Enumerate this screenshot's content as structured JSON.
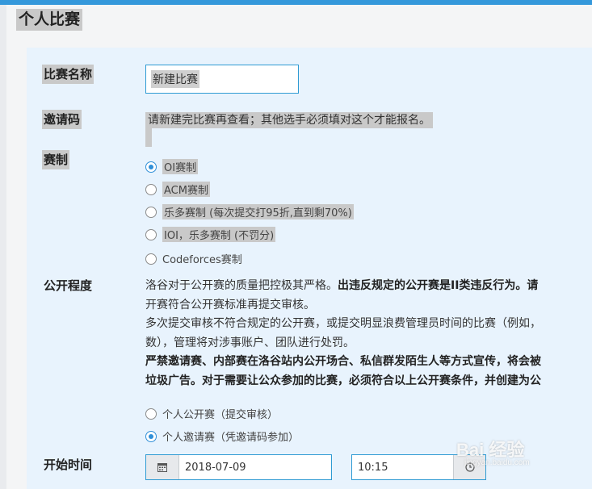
{
  "page": {
    "title": "个人比赛"
  },
  "form": {
    "name": {
      "label": "比赛名称",
      "value": "新建比赛"
    },
    "invite": {
      "label": "邀请码",
      "text": "请新建完比赛再查看；其他选手必须填对这个才能报名。"
    },
    "format": {
      "label": "赛制",
      "options": [
        {
          "label": "OI赛制",
          "checked": true
        },
        {
          "label": "ACM赛制",
          "checked": false
        },
        {
          "label": "乐多赛制 (每次提交打95折,直到剩70%)",
          "checked": false
        },
        {
          "label": "IOI，乐多赛制 (不罚分)",
          "checked": false
        },
        {
          "label": "Codeforces赛制",
          "checked": false
        }
      ]
    },
    "visibility": {
      "label": "公开程度",
      "paragraph": {
        "line1a": "洛谷对于公开赛的质量把控极其严格。",
        "line1b": "出违反规定的公开赛是II类违反行为。",
        "line1c": "请",
        "line2": "开赛符合公开赛标准再提交审核。",
        "line3": "多次提交审核不符合规定的公开赛，或提交明显浪费管理员时间的比赛（例如，",
        "line4": "数），管理将对涉事账户、团队进行处罚。",
        "line5": "严禁邀请赛、内部赛在洛谷站内公开场合、私信群发陌生人等方式宣传，将会被",
        "line6": "垃圾广告。对于需要让公众参加的比赛，必须符合以上公开赛条件，并创建为公"
      },
      "options": [
        {
          "label": "个人公开赛（提交审核）",
          "checked": false
        },
        {
          "label": "个人邀请赛（凭邀请码参加）",
          "checked": true
        }
      ]
    },
    "start": {
      "label": "开始时间",
      "date": "2018-07-09",
      "time": "10:15"
    }
  },
  "watermark": {
    "text": "Bai 经验",
    "sub": "jingyan.baidu.com"
  },
  "icons": {
    "calendar": "calendar-icon",
    "clock": "clock-icon"
  },
  "colors": {
    "accent": "#3498db",
    "panel": "#e8f3fd",
    "highlight": "#c9c9c9"
  }
}
